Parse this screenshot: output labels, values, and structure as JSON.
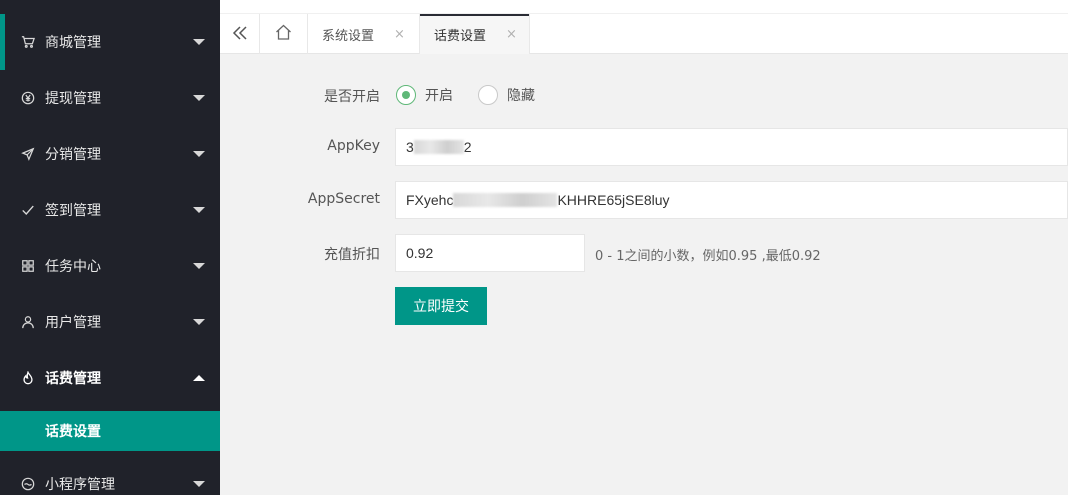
{
  "sidebar": {
    "items": [
      {
        "label": "商城管理",
        "icon": "cart-icon"
      },
      {
        "label": "提现管理",
        "icon": "yen-icon"
      },
      {
        "label": "分销管理",
        "icon": "send-icon"
      },
      {
        "label": "签到管理",
        "icon": "check-icon"
      },
      {
        "label": "任务中心",
        "icon": "grid-icon"
      },
      {
        "label": "用户管理",
        "icon": "user-icon"
      },
      {
        "label": "话费管理",
        "icon": "fire-icon"
      },
      {
        "label": "小程序管理",
        "icon": "mini-program-icon"
      }
    ],
    "sub_item": "话费设置"
  },
  "tabs": [
    {
      "label": "系统设置",
      "close": "×"
    },
    {
      "label": "话费设置",
      "close": "×"
    }
  ],
  "form": {
    "enable_label": "是否开启",
    "enable_options": [
      "开启",
      "隐藏"
    ],
    "enable_selected": "开启",
    "appkey_label": "AppKey",
    "appkey_prefix": "3",
    "appkey_suffix": "2",
    "appsecret_label": "AppSecret",
    "appsecret_prefix": "FXyehc",
    "appsecret_suffix": "KHHRE65jSE8luy",
    "discount_label": "充值折扣",
    "discount_value": "0.92",
    "discount_hint": "0 - 1之间的小数，例如0.95 ,最低0.92",
    "submit_label": "立即提交"
  },
  "colors": {
    "accent": "#009688",
    "sidebar_bg": "#20222a",
    "radio_checked": "#5fb878"
  }
}
